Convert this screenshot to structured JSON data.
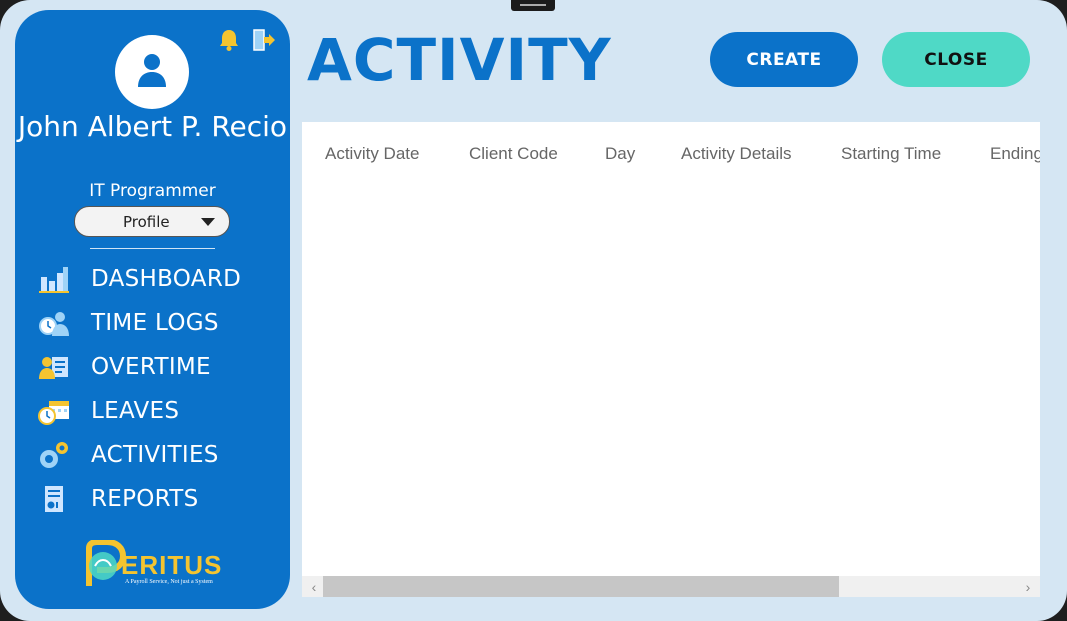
{
  "user": {
    "name": "John Albert P. Recio",
    "role": "IT Programmer",
    "profile_select": "Profile"
  },
  "nav": {
    "items": [
      {
        "label": "DASHBOARD",
        "icon": "dashboard-chart-icon"
      },
      {
        "label": "TIME LOGS",
        "icon": "time-logs-icon"
      },
      {
        "label": "OVERTIME",
        "icon": "overtime-icon"
      },
      {
        "label": "LEAVES",
        "icon": "leaves-icon"
      },
      {
        "label": "ACTIVITIES",
        "icon": "activities-gears-icon"
      },
      {
        "label": "REPORTS",
        "icon": "reports-icon"
      }
    ]
  },
  "logo": {
    "text": "ERITUS",
    "tagline": "A Payroll Service, Not just a System"
  },
  "page": {
    "title": "ACTIVITY",
    "create_label": "CREATE",
    "close_label": "CLOSE"
  },
  "table": {
    "columns": [
      "Activity Date",
      "Client Code",
      "Day",
      "Activity Details",
      "Starting Time",
      "Ending"
    ]
  },
  "colors": {
    "primary": "#0b72c9",
    "accent": "#4fd9c6",
    "background": "#d5e6f3",
    "bell": "#f4c430"
  }
}
